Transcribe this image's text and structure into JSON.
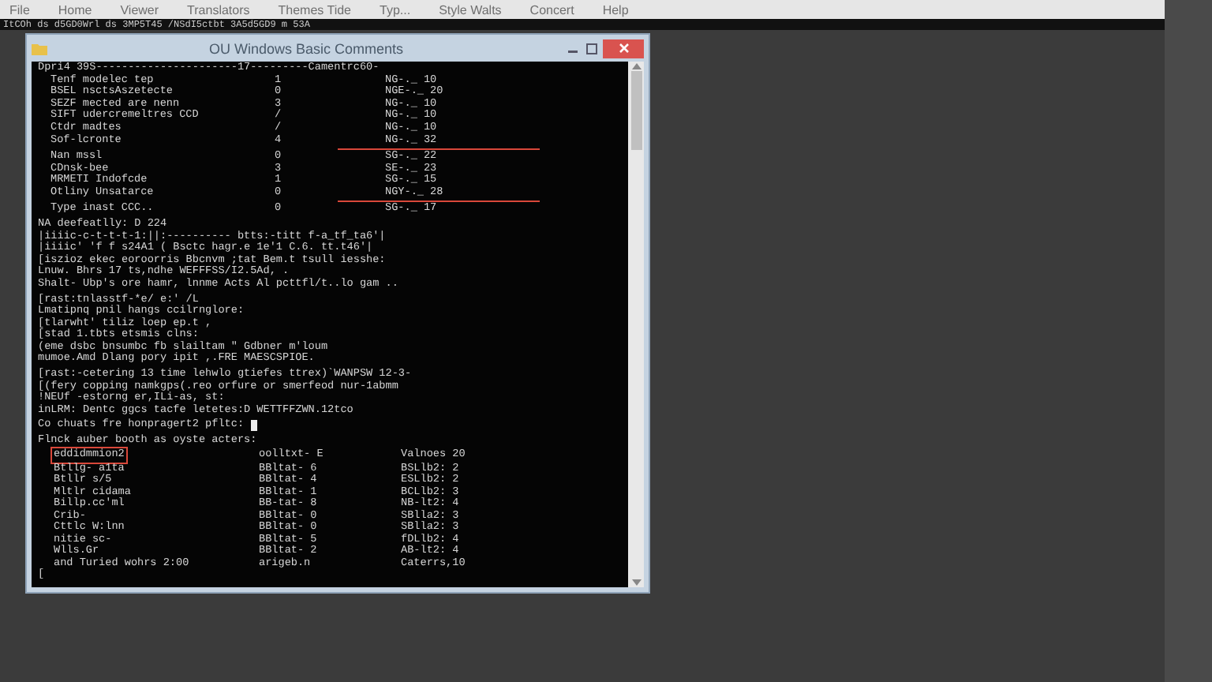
{
  "menu_bar": {
    "items": [
      "File",
      "Home",
      "Viewer",
      "Translators",
      "Themes Tide",
      "Typ...",
      "Style Walts",
      "Concert",
      "Help"
    ]
  },
  "path_bar": {
    "text": "ItCOh ds d5GD0Wrl ds 3MP5T45 /NSdI5ctbt 3A5d5GD9 m 53A"
  },
  "console_window": {
    "title": "OU Windows Basic Comments",
    "table": {
      "header": "Dpri4 39S----------------------17---------Camentrc60-",
      "rows": [
        {
          "name": "Tenf modelec tep",
          "count": "1",
          "value": "NG-._ 10",
          "struck": false
        },
        {
          "name": "BSEL nsctsAszetecte",
          "count": "0",
          "value": "NGE-._ 20",
          "struck": false
        },
        {
          "name": "SEZF mected are nenn",
          "count": "3",
          "value": "NG-._ 10",
          "struck": false
        },
        {
          "name": "SIFT udercremeltres CCD",
          "count": "/",
          "value": "NG-._ 10",
          "struck": false
        },
        {
          "name": "Ctdr madtes",
          "count": "/",
          "value": "NG-._ 10",
          "struck": false
        },
        {
          "name": "Sof-lcronte",
          "count": "4",
          "value": "NG-._ 32",
          "struck": true
        },
        {
          "name": "Nan mssl",
          "count": "0",
          "value": "SG-._ 22",
          "struck": false
        },
        {
          "name": "CDnsk-bee",
          "count": "3",
          "value": "SE-._ 23",
          "struck": false
        },
        {
          "name": "MRMETI Indofcde",
          "count": "1",
          "value": "SG-._ 15",
          "struck": false
        },
        {
          "name": "Otliny Unsatarce",
          "count": "0",
          "value": "NGY-._ 28",
          "struck": true
        },
        {
          "name": "Type inast CCC..",
          "count": "0",
          "value": "SG-._ 17",
          "struck": false
        }
      ]
    },
    "blocks": [
      [
        "NA deefeatlly: D 224",
        "|iiiic-c-t-t-t-1:||:---------- btts:-titt f-a_tf_ta6'|",
        "|iiiic' 'f f s24A1 ( Bsctc hagr.e 1e'1 C.6. tt.t46'|",
        "[iszioz ekec eoroorris Bbcnvm ;tat Bem.t tsull iesshe:",
        "Lnuw. Bhrs 17 ts,ndhe WEFFFSS/I2.5Ad, .",
        "Shalt- Ubp's ore hamr, lnnme Acts Al pcttfl/t..lo gam .."
      ],
      [
        "[rast:tnlasstf-*e/ e:' /L",
        "Lmatipnq pnil hangs ccilrnglore:",
        "[tlarwht' tiliz loep ep.t ,",
        "[stad 1.tbts etsmis clns:",
        "(eme dsbc bnsumbc fb slailtam \" Gdbner m'loum",
        "mumoe.Amd Dlang pory ipit ,.FRE MAESCSPIOE."
      ],
      [
        "[rast:-cetering 13 time lehwlo gtiefes ttrex)`WANPSW 12-3-",
        "[(fery copping namkgps(.reo orfure or smerfeod nur-1abmm",
        "!NEUf -estorng er,ILi-as, st:",
        "inLRM: Dentc ggcs tacfe letetes:D WETTFFZWN.12tco"
      ]
    ],
    "prompt": "Co chuats fre honpragert2 pfltc:",
    "list": {
      "header": "Flnck auber booth as oyste acters:",
      "rows": [
        {
          "col_1": "eddidmmion2",
          "col_2": "oolltxt- E",
          "col_3": "Valnoes 20",
          "selected": true
        },
        {
          "col_1": "Btllg- a1ta",
          "col_2": "BBltat- 6",
          "col_3": "BSLlb2: 2",
          "selected": false
        },
        {
          "col_1": "Btllr s/5",
          "col_2": "BBltat- 4",
          "col_3": "ESLlb2: 2",
          "selected": false
        },
        {
          "col_1": "Mltlr cidama",
          "col_2": "BBltat- 1",
          "col_3": "BCLlb2: 3",
          "selected": false
        },
        {
          "col_1": "Billp.cc'ml",
          "col_2": "BB-tat- 8",
          "col_3": "NB-lt2: 4",
          "selected": false
        },
        {
          "col_1": "Crib-",
          "col_2": "BBltat- 0",
          "col_3": "SBlla2: 3",
          "selected": false
        },
        {
          "col_1": "Cttlc W:lnn",
          "col_2": "BBltat- 0",
          "col_3": "SBlla2: 3",
          "selected": false
        },
        {
          "col_1": "nitie sc-",
          "col_2": "BBltat- 5",
          "col_3": "fDLlb2: 4",
          "selected": false
        },
        {
          "col_1": "Wlls.Gr",
          "col_2": "BBltat- 2",
          "col_3": "AB-lt2: 4",
          "selected": false
        },
        {
          "col_1": "and Turied wohrs 2:00",
          "col_2": "arigeb.n",
          "col_3": "Caterrs,10",
          "selected": false
        }
      ]
    },
    "final_line": "["
  }
}
